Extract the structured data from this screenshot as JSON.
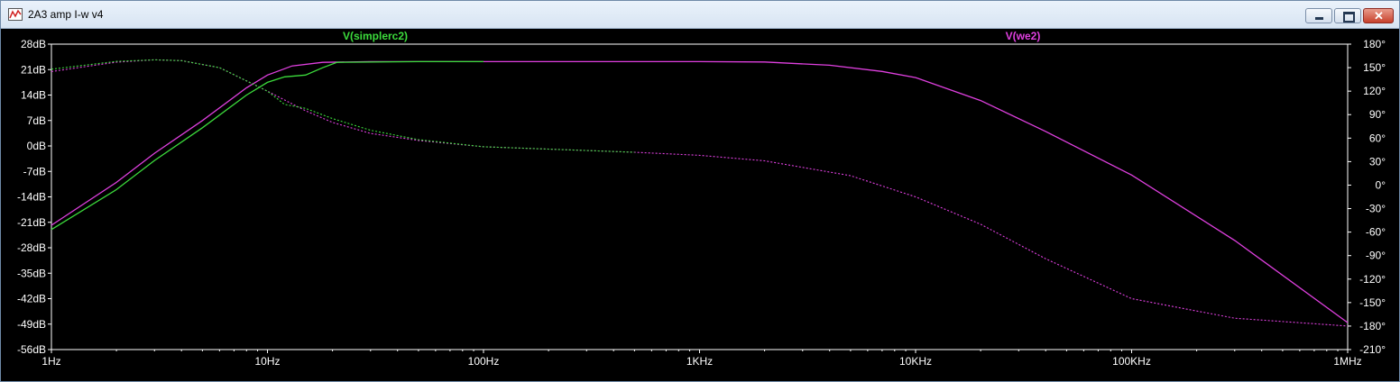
{
  "window": {
    "title": "2A3 amp I-w v4",
    "minimize_label": "Minimize",
    "maximize_label": "Maximize",
    "close_label": "Close",
    "close_glyph": "✕"
  },
  "chart_data": {
    "type": "line",
    "x_scale": "log",
    "xlim": [
      1,
      1000000
    ],
    "x_ticks": [
      {
        "value": 1,
        "label": "1Hz"
      },
      {
        "value": 10,
        "label": "10Hz"
      },
      {
        "value": 100,
        "label": "100Hz"
      },
      {
        "value": 1000,
        "label": "1KHz"
      },
      {
        "value": 10000,
        "label": "10KHz"
      },
      {
        "value": 100000,
        "label": "100KHz"
      },
      {
        "value": 1000000,
        "label": "1MHz"
      }
    ],
    "ylim_left": [
      -56,
      28
    ],
    "y_ticks_left": [
      {
        "value": 28,
        "label": "28dB"
      },
      {
        "value": 21,
        "label": "21dB"
      },
      {
        "value": 14,
        "label": "14dB"
      },
      {
        "value": 7,
        "label": "7dB"
      },
      {
        "value": 0,
        "label": "0dB"
      },
      {
        "value": -7,
        "label": "-7dB"
      },
      {
        "value": -14,
        "label": "-14dB"
      },
      {
        "value": -21,
        "label": "-21dB"
      },
      {
        "value": -28,
        "label": "-28dB"
      },
      {
        "value": -35,
        "label": "-35dB"
      },
      {
        "value": -42,
        "label": "-42dB"
      },
      {
        "value": -49,
        "label": "-49dB"
      },
      {
        "value": -56,
        "label": "-56dB"
      }
    ],
    "ylim_right": [
      -210,
      180
    ],
    "y_ticks_right": [
      {
        "value": 180,
        "label": "180°"
      },
      {
        "value": 150,
        "label": "150°"
      },
      {
        "value": 120,
        "label": "120°"
      },
      {
        "value": 90,
        "label": "90°"
      },
      {
        "value": 60,
        "label": "60°"
      },
      {
        "value": 30,
        "label": "30°"
      },
      {
        "value": 0,
        "label": "0°"
      },
      {
        "value": -30,
        "label": "-30°"
      },
      {
        "value": -60,
        "label": "-60°"
      },
      {
        "value": -90,
        "label": "-90°"
      },
      {
        "value": -120,
        "label": "-120°"
      },
      {
        "value": -150,
        "label": "-150°"
      },
      {
        "value": -180,
        "label": "-180°"
      },
      {
        "value": -210,
        "label": "-210°"
      }
    ],
    "grid": false,
    "series": [
      {
        "name": "V(we2)",
        "color": "#e040e0",
        "magnitude_db": [
          [
            1,
            -21.8
          ],
          [
            2,
            -10
          ],
          [
            3,
            -2
          ],
          [
            5,
            7
          ],
          [
            8,
            16
          ],
          [
            10,
            19.5
          ],
          [
            13,
            22
          ],
          [
            18,
            23
          ],
          [
            30,
            23.2
          ],
          [
            100,
            23.2
          ],
          [
            1000,
            23.2
          ],
          [
            2000,
            23.1
          ],
          [
            4000,
            22.2
          ],
          [
            7000,
            20.5
          ],
          [
            10000,
            18.8
          ],
          [
            20000,
            12.5
          ],
          [
            40000,
            4
          ],
          [
            100000,
            -8
          ],
          [
            300000,
            -26
          ],
          [
            1000000,
            -48.6
          ]
        ],
        "phase_deg": [
          [
            1,
            145
          ],
          [
            2,
            157
          ],
          [
            3,
            160
          ],
          [
            4,
            159
          ],
          [
            6,
            150
          ],
          [
            10,
            120
          ],
          [
            15,
            95
          ],
          [
            20,
            80
          ],
          [
            30,
            66
          ],
          [
            50,
            57
          ],
          [
            100,
            49
          ],
          [
            200,
            46
          ],
          [
            500,
            42
          ],
          [
            1000,
            38
          ],
          [
            2000,
            31
          ],
          [
            5000,
            12
          ],
          [
            10000,
            -15
          ],
          [
            20000,
            -50
          ],
          [
            40000,
            -94
          ],
          [
            100000,
            -145
          ],
          [
            300000,
            -170
          ],
          [
            1000000,
            -180
          ]
        ]
      },
      {
        "name": "V(simplerc2)",
        "color": "#3cdc3c",
        "magnitude_db": [
          [
            1,
            -23
          ],
          [
            2,
            -12
          ],
          [
            3,
            -4
          ],
          [
            5,
            5
          ],
          [
            8,
            14
          ],
          [
            10,
            17.5
          ],
          [
            12,
            19
          ],
          [
            15,
            19.5
          ],
          [
            18,
            21.5
          ],
          [
            21,
            23
          ],
          [
            50,
            23.2
          ],
          [
            100,
            23.2
          ]
        ],
        "phase_deg": [
          [
            1,
            148
          ],
          [
            2,
            158
          ],
          [
            3,
            160
          ],
          [
            4,
            159
          ],
          [
            6,
            150
          ],
          [
            10,
            120
          ],
          [
            12,
            103
          ],
          [
            15,
            98
          ],
          [
            20,
            85
          ],
          [
            30,
            70
          ],
          [
            50,
            58
          ],
          [
            100,
            49
          ],
          [
            200,
            46
          ],
          [
            500,
            42
          ]
        ]
      }
    ]
  }
}
